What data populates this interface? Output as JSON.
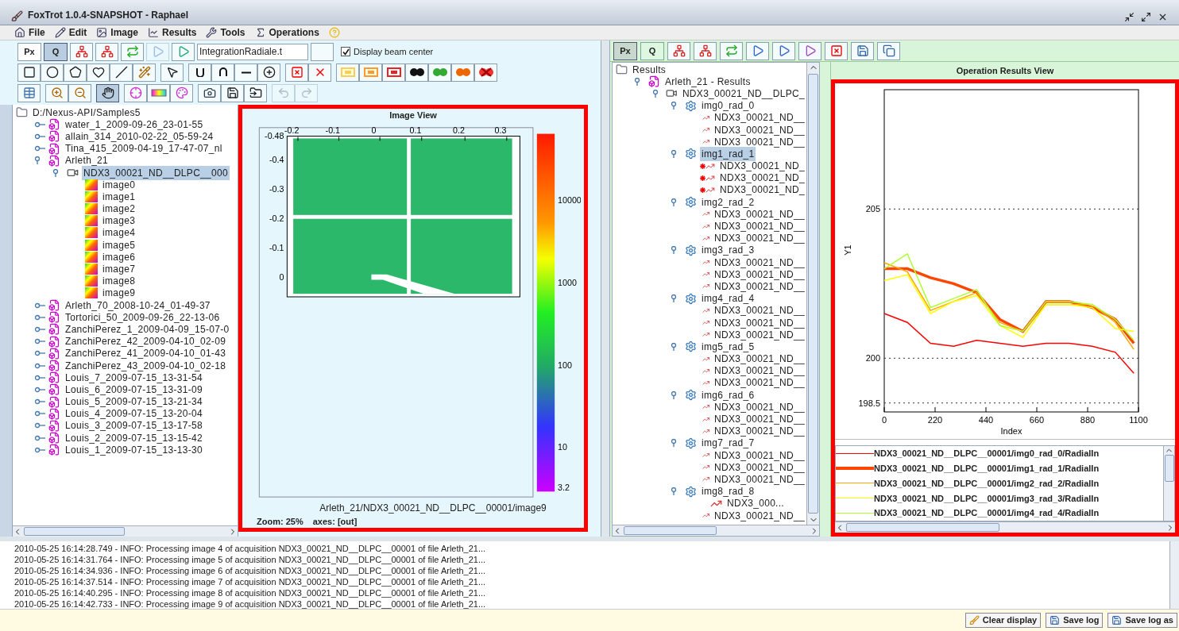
{
  "window": {
    "title": "FoxTrot 1.0.4-SNAPSHOT - Raphael"
  },
  "menu": [
    {
      "label": "File",
      "kind": "file"
    },
    {
      "label": "Edit",
      "kind": "edit"
    },
    {
      "label": "Image",
      "kind": "image"
    },
    {
      "label": "Results",
      "kind": "results"
    },
    {
      "label": "Tools",
      "kind": "tools"
    },
    {
      "label": "Operations",
      "kind": "operations"
    },
    {
      "kind": "help"
    }
  ],
  "left_toolbar": {
    "unit_toggle": [
      {
        "label": "Px",
        "selected": false
      },
      {
        "label": "Q",
        "selected": true
      }
    ],
    "row1_buttons": [
      {
        "kind": "tree-add",
        "disabled": false
      },
      {
        "kind": "tree-add",
        "disabled": false
      },
      {
        "kind": "convert",
        "disabled": false
      },
      {
        "kind": "play",
        "disabled": true
      },
      {
        "kind": "run",
        "disabled": false
      }
    ],
    "script_field": {
      "value": "IntegrationRadiale.t"
    },
    "beam_center_checkbox": {
      "label": "Display beam center",
      "checked": true
    },
    "row2_groups": [
      [
        {
          "kind": "rect",
          "selected": false
        },
        {
          "kind": "ellipse",
          "selected": false
        },
        {
          "kind": "polygon",
          "selected": false
        },
        {
          "kind": "heart",
          "selected": false
        },
        {
          "kind": "line",
          "selected": false
        },
        {
          "kind": "wand",
          "selected": false
        }
      ],
      [
        {
          "kind": "pointer",
          "selected": false
        }
      ],
      [
        {
          "kind": "union",
          "selected": false
        },
        {
          "kind": "intersection",
          "selected": false
        },
        {
          "kind": "minus",
          "selected": false
        },
        {
          "kind": "plus",
          "selected": false
        }
      ],
      [
        {
          "kind": "delete",
          "selected": false
        },
        {
          "kind": "delete-cut",
          "selected": false
        }
      ],
      [
        {
          "kind": "mask-yellow",
          "selected": false
        },
        {
          "kind": "mask-gradient",
          "selected": false
        },
        {
          "kind": "mask-red",
          "selected": false
        },
        {
          "kind": "mask-black",
          "selected": false
        },
        {
          "kind": "mask-green",
          "selected": false
        },
        {
          "kind": "mask-orange",
          "selected": false
        },
        {
          "kind": "mask-cross",
          "selected": false
        }
      ]
    ],
    "row3_groups": [
      [
        {
          "kind": "table",
          "disabled": false,
          "selected": false
        }
      ],
      [
        {
          "kind": "zoom-in",
          "disabled": false,
          "selected": false
        },
        {
          "kind": "zoom-out",
          "disabled": false,
          "selected": false
        }
      ],
      [
        {
          "kind": "hand",
          "disabled": false,
          "selected": true
        }
      ],
      [
        {
          "kind": "crosshair",
          "disabled": false,
          "selected": false
        },
        {
          "kind": "colorbar",
          "disabled": false,
          "selected": false
        },
        {
          "kind": "palette",
          "disabled": false,
          "selected": false
        }
      ],
      [
        {
          "kind": "camera",
          "disabled": false,
          "selected": false
        },
        {
          "kind": "save-mask",
          "disabled": false,
          "selected": false
        },
        {
          "kind": "load-mask",
          "disabled": false,
          "selected": false
        }
      ],
      [
        {
          "kind": "undo",
          "disabled": true,
          "selected": false
        },
        {
          "kind": "redo",
          "disabled": true,
          "selected": false
        }
      ]
    ]
  },
  "file_tree": {
    "label": "D:/Nexus-API/Samples5",
    "kind": "folder",
    "selected": false,
    "children": [
      {
        "label": "water_1_2009-09-26_23-01-55",
        "kind": "nexus",
        "expanded": false,
        "selected": false
      },
      {
        "label": "allain_314_2010-02-22_05-59-24",
        "kind": "nexus",
        "expanded": false,
        "selected": false
      },
      {
        "label": "Tina_415_2009-04-19_17-47-07_nl",
        "kind": "nexus",
        "expanded": false,
        "selected": false
      },
      {
        "label": "Arleth_21",
        "kind": "nexus",
        "expanded": true,
        "selected": false,
        "children": [
          {
            "label": "NDX3_00021_ND__DLPC__000",
            "kind": "acquisition",
            "expanded": true,
            "selected": true,
            "children": [
              {
                "label": "image0",
                "kind": "image",
                "selected": false
              },
              {
                "label": "image1",
                "kind": "image",
                "selected": false
              },
              {
                "label": "image2",
                "kind": "image",
                "selected": false
              },
              {
                "label": "image3",
                "kind": "image",
                "selected": false
              },
              {
                "label": "image4",
                "kind": "image",
                "selected": false
              },
              {
                "label": "image5",
                "kind": "image",
                "selected": false
              },
              {
                "label": "image6",
                "kind": "image",
                "selected": false
              },
              {
                "label": "image7",
                "kind": "image",
                "selected": false
              },
              {
                "label": "image8",
                "kind": "image",
                "selected": false
              },
              {
                "label": "image9",
                "kind": "image",
                "selected": false
              }
            ]
          }
        ]
      },
      {
        "label": "Arleth_70_2008-10-24_01-49-37",
        "kind": "nexus",
        "expanded": false,
        "selected": false
      },
      {
        "label": "Tortorici_50_2009-09-26_22-13-06",
        "kind": "nexus",
        "expanded": false,
        "selected": false
      },
      {
        "label": "ZanchiPerez_1_2009-04-09_15-07-0",
        "kind": "nexus",
        "expanded": false,
        "selected": false
      },
      {
        "label": "ZanchiPerez_42_2009-04-10_02-09",
        "kind": "nexus",
        "expanded": false,
        "selected": false
      },
      {
        "label": "ZanchiPerez_41_2009-04-10_01-43",
        "kind": "nexus",
        "expanded": false,
        "selected": false
      },
      {
        "label": "ZanchiPerez_43_2009-04-10_02-18",
        "kind": "nexus",
        "expanded": false,
        "selected": false
      },
      {
        "label": "Louis_7_2009-07-15_13-31-54",
        "kind": "nexus",
        "expanded": false,
        "selected": false
      },
      {
        "label": "Louis_6_2009-07-15_13-31-09",
        "kind": "nexus",
        "expanded": false,
        "selected": false
      },
      {
        "label": "Louis_5_2009-07-15_13-21-34",
        "kind": "nexus",
        "expanded": false,
        "selected": false
      },
      {
        "label": "Louis_4_2009-07-15_13-20-04",
        "kind": "nexus",
        "expanded": false,
        "selected": false
      },
      {
        "label": "Louis_3_2009-07-15_13-17-58",
        "kind": "nexus",
        "expanded": false,
        "selected": false
      },
      {
        "label": "Louis_2_2009-07-15_13-15-42",
        "kind": "nexus",
        "expanded": false,
        "selected": false
      },
      {
        "label": "Louis_1_2009-07-15_13-13-30",
        "kind": "nexus",
        "expanded": false,
        "selected": false
      }
    ]
  },
  "image_view": {
    "title": "Image View",
    "x_ticks": [
      "-0.2",
      "-0.1",
      "0",
      "0.1",
      "0.2",
      "0.3"
    ],
    "y_ticks": [
      "-0.48",
      "-0.4",
      "-0.3",
      "-0.2",
      "-0.1",
      "0"
    ],
    "colorbar_ticks": [
      "10000",
      "1000",
      "100",
      "10",
      "3.2"
    ],
    "caption": "Arleth_21/NDX3_00021_ND__DLPC__00001/image9",
    "zoom": "Zoom: 25%",
    "axes": "axes: [out]"
  },
  "right_toolbar": {
    "unit_toggle": [
      {
        "label": "Px",
        "selected": true
      },
      {
        "label": "Q",
        "selected": false
      }
    ],
    "buttons": [
      {
        "kind": "tree-add"
      },
      {
        "kind": "tree-add"
      },
      {
        "kind": "convert"
      },
      {
        "kind": "play"
      },
      {
        "kind": "play-star"
      },
      {
        "kind": "play-edit"
      },
      {
        "kind": "delete"
      },
      {
        "kind": "save"
      },
      {
        "kind": "copy"
      }
    ]
  },
  "results_tree": {
    "label": "Results",
    "kind": "folder",
    "selected": false,
    "children": [
      {
        "label": "Arleth_21 - Results",
        "kind": "nexus",
        "expanded": true,
        "selected": false,
        "children": [
          {
            "label": "NDX3_00021_ND__DLPC_",
            "kind": "acquisition",
            "expanded": true,
            "selected": false,
            "children": [
              {
                "label": "img0_rad_0",
                "kind": "operation",
                "expanded": true,
                "selected": false,
                "children": [
                  {
                    "label": "NDX3_00021_ND__",
                    "kind": "curve",
                    "starred": false,
                    "selected": false
                  },
                  {
                    "label": "NDX3_00021_ND__",
                    "kind": "curve",
                    "starred": false,
                    "selected": false
                  },
                  {
                    "label": "NDX3_00021_ND__",
                    "kind": "curve",
                    "starred": false,
                    "selected": false
                  }
                ]
              },
              {
                "label": "img1_rad_1",
                "kind": "operation",
                "expanded": true,
                "selected": true,
                "children": [
                  {
                    "label": "NDX3_00021_ND_",
                    "kind": "curve",
                    "starred": true,
                    "selected": false
                  },
                  {
                    "label": "NDX3_00021_ND_",
                    "kind": "curve",
                    "starred": true,
                    "selected": false
                  },
                  {
                    "label": "NDX3_00021_ND_",
                    "kind": "curve",
                    "starred": true,
                    "selected": false
                  }
                ]
              },
              {
                "label": "img2_rad_2",
                "kind": "operation",
                "expanded": true,
                "selected": false,
                "children": [
                  {
                    "label": "NDX3_00021_ND__",
                    "kind": "curve",
                    "starred": false,
                    "selected": false
                  },
                  {
                    "label": "NDX3_00021_ND__",
                    "kind": "curve",
                    "starred": false,
                    "selected": false
                  },
                  {
                    "label": "NDX3_00021_ND__",
                    "kind": "curve",
                    "starred": false,
                    "selected": false
                  }
                ]
              },
              {
                "label": "img3_rad_3",
                "kind": "operation",
                "expanded": true,
                "selected": false,
                "children": [
                  {
                    "label": "NDX3_00021_ND__",
                    "kind": "curve",
                    "starred": false,
                    "selected": false
                  },
                  {
                    "label": "NDX3_00021_ND__",
                    "kind": "curve",
                    "starred": false,
                    "selected": false
                  },
                  {
                    "label": "NDX3_00021_ND__",
                    "kind": "curve",
                    "starred": false,
                    "selected": false
                  }
                ]
              },
              {
                "label": "img4_rad_4",
                "kind": "operation",
                "expanded": true,
                "selected": false,
                "children": [
                  {
                    "label": "NDX3_00021_ND__",
                    "kind": "curve",
                    "starred": false,
                    "selected": false
                  },
                  {
                    "label": "NDX3_00021_ND__",
                    "kind": "curve",
                    "starred": false,
                    "selected": false
                  },
                  {
                    "label": "NDX3_00021_ND__",
                    "kind": "curve",
                    "starred": false,
                    "selected": false
                  }
                ]
              },
              {
                "label": "img5_rad_5",
                "kind": "operation",
                "expanded": true,
                "selected": false,
                "children": [
                  {
                    "label": "NDX3_00021_ND__",
                    "kind": "curve",
                    "starred": false,
                    "selected": false
                  },
                  {
                    "label": "NDX3_00021_ND__",
                    "kind": "curve",
                    "starred": false,
                    "selected": false
                  },
                  {
                    "label": "NDX3_00021_ND__",
                    "kind": "curve",
                    "starred": false,
                    "selected": false
                  }
                ]
              },
              {
                "label": "img6_rad_6",
                "kind": "operation",
                "expanded": true,
                "selected": false,
                "children": [
                  {
                    "label": "NDX3_00021_ND__",
                    "kind": "curve",
                    "starred": false,
                    "selected": false
                  },
                  {
                    "label": "NDX3_00021_ND__",
                    "kind": "curve",
                    "starred": false,
                    "selected": false
                  },
                  {
                    "label": "NDX3_00021_ND__",
                    "kind": "curve",
                    "starred": false,
                    "selected": false
                  }
                ]
              },
              {
                "label": "img7_rad_7",
                "kind": "operation",
                "expanded": true,
                "selected": false,
                "children": [
                  {
                    "label": "NDX3_00021_ND__",
                    "kind": "curve",
                    "starred": false,
                    "selected": false
                  },
                  {
                    "label": "NDX3_00021_ND__",
                    "kind": "curve",
                    "starred": false,
                    "selected": false
                  },
                  {
                    "label": "NDX3_00021_ND__",
                    "kind": "curve",
                    "starred": false,
                    "selected": false
                  }
                ]
              },
              {
                "label": "img8_rad_8",
                "kind": "operation",
                "expanded": true,
                "selected": false,
                "children": [
                  {
                    "label": "NDX3_000...",
                    "kind": "curve",
                    "starred": false,
                    "selected": false
                  },
                  {
                    "label": "NDX3_00021_ND__",
                    "kind": "curve",
                    "starred": false,
                    "selected": false
                  }
                ]
              }
            ]
          }
        ]
      }
    ]
  },
  "results_view": {
    "title": "Operation Results View",
    "chart_data": {
      "type": "line",
      "grid": true,
      "xlabel": "Index",
      "ylabel": "Y1",
      "x": [
        0,
        100,
        200,
        300,
        400,
        500,
        600,
        700,
        800,
        900,
        1000,
        1080
      ],
      "xlim": [
        0,
        1100
      ],
      "ylim": [
        198.2,
        209
      ],
      "xticks": [
        0,
        220,
        440,
        660,
        880,
        1100
      ],
      "yticks": [
        198.5,
        200,
        205
      ],
      "series": [
        {
          "name": "NDX3_00021_ND__DLPC__00001/img0_rad_0/RadialIn",
          "color": "#ff0000",
          "values": [
            201.5,
            201.2,
            200.5,
            200.4,
            200.6,
            200.5,
            200.4,
            200.5,
            200.5,
            200.4,
            200.2,
            199.5
          ]
        },
        {
          "name": "NDX3_00021_ND__DLPC__00001/img1_rad_1/RadialIn",
          "color": "#ff4500",
          "values": [
            203,
            203,
            202.7,
            202.5,
            202.2,
            201.3,
            200.9,
            201.9,
            201.9,
            201.7,
            201.3,
            200.5
          ]
        },
        {
          "name": "NDX3_00021_ND__DLPC__00001/img2_rad_2/RadialIn",
          "color": "#ffa500",
          "values": [
            203.2,
            202.9,
            201.6,
            201.9,
            202.2,
            201.2,
            200.9,
            201.8,
            201.8,
            201.8,
            201.2,
            200.3
          ]
        },
        {
          "name": "NDX3_00021_ND__DLPC__00001/img3_rad_3/RadialIn",
          "color": "#ffff00",
          "values": [
            202.6,
            202.8,
            201.5,
            201.9,
            202.1,
            201.1,
            200.7,
            201.8,
            201.8,
            201.7,
            201.0,
            200.9
          ]
        },
        {
          "name": "NDX3_00021_ND__DLPC__00001/img4_rad_4/RadialIn",
          "color": "#adff2f",
          "values": [
            203,
            203.5,
            201.7,
            202,
            202.3,
            201.1,
            200.9,
            201.9,
            201.9,
            201.8,
            201.3,
            200.6
          ]
        }
      ]
    },
    "legend": [
      {
        "selected": false
      },
      {
        "selected": true
      },
      {
        "selected": false
      },
      {
        "selected": false
      },
      {
        "selected": false
      }
    ]
  },
  "log": [
    "2010-05-25 16:14:28.749 - INFO: Processing image 4 of acquisition NDX3_00021_ND__DLPC__00001 of file Arleth_21...",
    "2010-05-25 16:14:31.764 - INFO: Processing image 5 of acquisition NDX3_00021_ND__DLPC__00001 of file Arleth_21...",
    "2010-05-25 16:14:34.936 - INFO: Processing image 6 of acquisition NDX3_00021_ND__DLPC__00001 of file Arleth_21...",
    "2010-05-25 16:14:37.514 - INFO: Processing image 7 of acquisition NDX3_00021_ND__DLPC__00001 of file Arleth_21...",
    "2010-05-25 16:14:40.295 - INFO: Processing image 8 of acquisition NDX3_00021_ND__DLPC__00001 of file Arleth_21...",
    "2010-05-25 16:14:42.733 - INFO: Processing image 9 of acquisition NDX3_00021_ND__DLPC__00001 of file Arleth_21..."
  ],
  "log_buttons": [
    {
      "label": "Clear display",
      "kind": "clear"
    },
    {
      "label": "Save log",
      "kind": "save"
    },
    {
      "label": "Save log as",
      "kind": "save"
    }
  ]
}
